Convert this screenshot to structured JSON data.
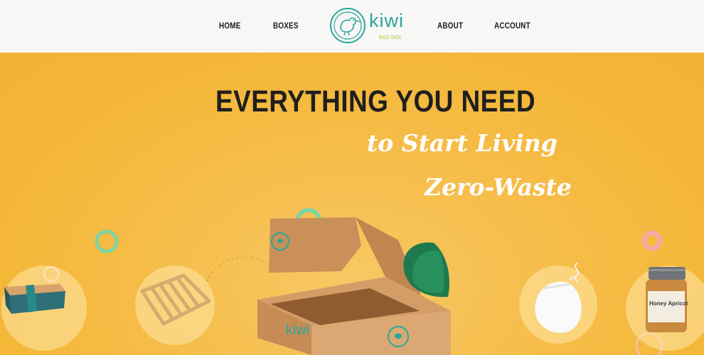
{
  "nav": {
    "items": [
      {
        "label": "HOME"
      },
      {
        "label": "BOXES"
      },
      {
        "label": "ABOUT"
      },
      {
        "label": "ACCOUNT"
      }
    ],
    "logo": {
      "word": "kiwi",
      "sub": "eco box"
    }
  },
  "hero": {
    "headline": "EVERYTHING YOU NEED",
    "line2": "to Start Living",
    "line3": "Zero-Waste"
  },
  "products": {
    "jar_label": "Honey Apricot",
    "box_brand": "kiwi"
  },
  "colors": {
    "background": "#f5b942",
    "nav": "#f7f7f6",
    "brand_teal": "#2aa79b",
    "brand_green": "#b5cf3c",
    "deco_green": "#7ed3a4",
    "deco_pink": "#f6a9a0"
  }
}
